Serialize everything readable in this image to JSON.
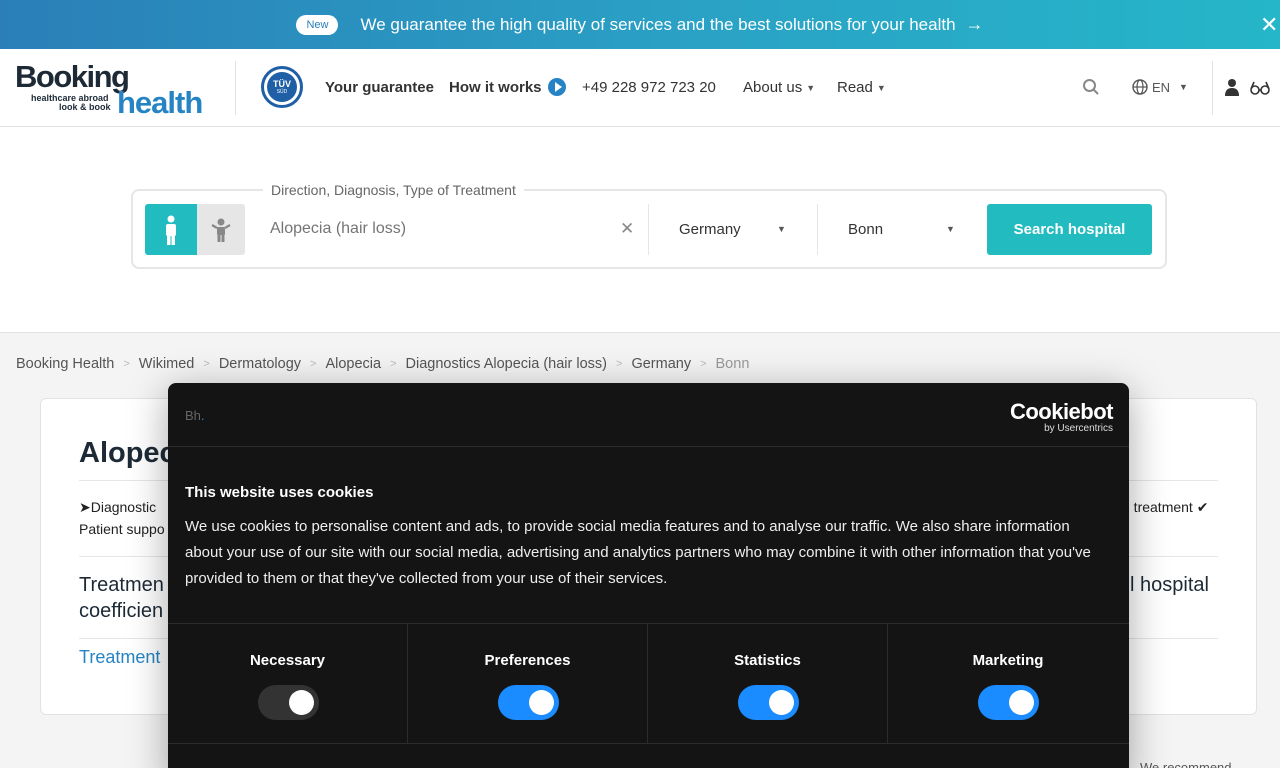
{
  "banner": {
    "badge": "New",
    "text": "We guarantee the high quality of services and the best solutions for your health",
    "arrow": "→",
    "close": "✕"
  },
  "header": {
    "logo": {
      "booking": "Booking",
      "sub1": "healthcare abroad",
      "sub2": "look & book",
      "health": "health"
    },
    "tuv": {
      "title": "TÜV",
      "sub": "SÜD"
    },
    "nav": {
      "guarantee": "Your guarantee",
      "how_it_works": "How it works",
      "phone": "+49 228 972 723 20",
      "about": "About us",
      "read": "Read"
    },
    "language": "EN"
  },
  "search": {
    "legend": "Direction, Diagnosis, Type of Treatment",
    "diagnosis_value": "Alopecia (hair loss)",
    "clear": "✕",
    "country": "Germany",
    "city": "Bonn",
    "button": "Search hospital"
  },
  "breadcrumb": [
    "Booking Health",
    "Wikimed",
    "Dermatology",
    "Alopecia",
    "Diagnostics Alopecia (hair loss)",
    "Germany",
    "Bonn"
  ],
  "content": {
    "title": "Alopec",
    "feature_line1": "➤Diagnostic",
    "feature_line2": "Patient suppo",
    "feature_right": "n treatment ✔",
    "treatment_line1": "Treatmen",
    "treatment_line2": "coefficien",
    "treatment_right": "l hospital",
    "treatment_link": "Treatment",
    "recommend": "We recommend"
  },
  "cookie": {
    "brand_small": {
      "b": "Bh",
      "dot": "."
    },
    "logo": "Cookiebot",
    "logo_sub": "by Usercentrics",
    "title": "This website uses cookies",
    "body": "We use cookies to personalise content and ads, to provide social media features and to analyse our traffic. We also share information about your use of our site with our social media, advertising and analytics partners who may combine it with other information that you've provided to them or that they've collected from your use of their services.",
    "categories": [
      {
        "label": "Necessary",
        "on": false
      },
      {
        "label": "Preferences",
        "on": true
      },
      {
        "label": "Statistics",
        "on": true
      },
      {
        "label": "Marketing",
        "on": true
      }
    ]
  },
  "colors": {
    "accent": "#22bcc0",
    "brand_blue": "#2784c4",
    "toggle_on": "#1a8cff"
  }
}
